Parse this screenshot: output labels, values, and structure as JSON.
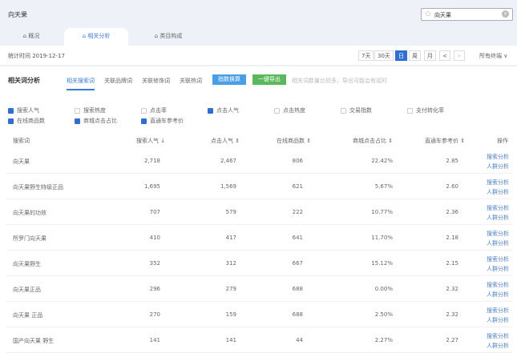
{
  "header": {
    "title": "向天果",
    "search_value": "向天果"
  },
  "tabs": [
    {
      "label": "概况"
    },
    {
      "label": "相关分析"
    },
    {
      "label": "类目构成"
    }
  ],
  "datebar": {
    "stat_time": "统计时间 2019-12-17",
    "periods": [
      "7天",
      "30天",
      "日",
      "周",
      "月"
    ],
    "active_period": "日",
    "prev": "<",
    "next": ">",
    "channel": "所有终端 ∨"
  },
  "section": {
    "title": "相关词分析",
    "subtabs": [
      "相关搜索词",
      "关联品牌词",
      "关联修饰词",
      "关联热词"
    ],
    "index_btn": "指数换算",
    "export_btn": "一键导出",
    "hint": "相关词数量比较多，导出可能会有延时"
  },
  "checkboxes": [
    {
      "label": "搜索人气",
      "checked": true
    },
    {
      "label": "搜索热度",
      "checked": false
    },
    {
      "label": "点击率",
      "checked": false
    },
    {
      "label": "点击人气",
      "checked": true
    },
    {
      "label": "点击热度",
      "checked": false
    },
    {
      "label": "交易指数",
      "checked": false
    },
    {
      "label": "支付转化率",
      "checked": false
    },
    {
      "label": "在线商品数",
      "checked": true
    },
    {
      "label": "商城点击占比",
      "checked": true
    },
    {
      "label": "直通车参考价",
      "checked": true
    }
  ],
  "table": {
    "headers": [
      "搜索词",
      "搜索人气 ↓",
      "点击人气 ⇕",
      "在线商品数 ⇕",
      "商城点击占比 ⇕",
      "直通车参考价 ⇕",
      "操作"
    ],
    "link1": "搜索分析",
    "link2": "人群分析",
    "rows": [
      [
        "向天果",
        "2,718",
        "2,467",
        "806",
        "22.42%",
        "2.85"
      ],
      [
        "向天果野生特级正品",
        "1,695",
        "1,569",
        "621",
        "5.67%",
        "2.60"
      ],
      [
        "向天果的功效",
        "707",
        "579",
        "222",
        "10.77%",
        "2.36"
      ],
      [
        "所罗门向天果",
        "410",
        "417",
        "641",
        "11.70%",
        "2.18"
      ],
      [
        "向天果野生",
        "352",
        "312",
        "667",
        "15.12%",
        "2.15"
      ],
      [
        "向天果正品",
        "296",
        "279",
        "688",
        "0.00%",
        "2.32"
      ],
      [
        "向天果 正品",
        "270",
        "159",
        "688",
        "2.50%",
        "2.32"
      ],
      [
        "国产向天果 野生",
        "141",
        "141",
        "44",
        "2.27%",
        "2.27"
      ]
    ]
  }
}
